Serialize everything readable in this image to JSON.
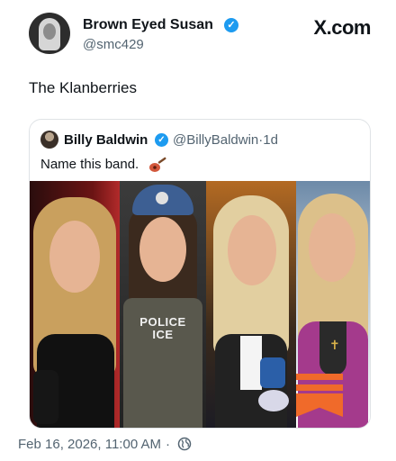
{
  "brand": "X.com",
  "author": {
    "display_name": "Brown Eyed Susan",
    "handle": "@smc429",
    "verified": true
  },
  "post": {
    "text": "The Klanberries"
  },
  "quoted_post": {
    "display_name": "Billy Baldwin",
    "handle": "@BillyBaldwin",
    "separator": "·",
    "age": "1d",
    "text": "Name this band.",
    "verified": true,
    "media": {
      "vest_label_line1": "POLICE",
      "vest_label_line2": "ICE"
    }
  },
  "footer": {
    "timestamp": "Feb 16, 2026, 11:00 AM",
    "separator": "·"
  },
  "icons": {
    "verified": "verified-badge-icon",
    "guitar": "guitar-emoji-icon",
    "visibility": "globe-icon"
  },
  "colors": {
    "verified_blue": "#1d9bf0",
    "secondary_text": "#536471",
    "primary_text": "#0f1419"
  }
}
